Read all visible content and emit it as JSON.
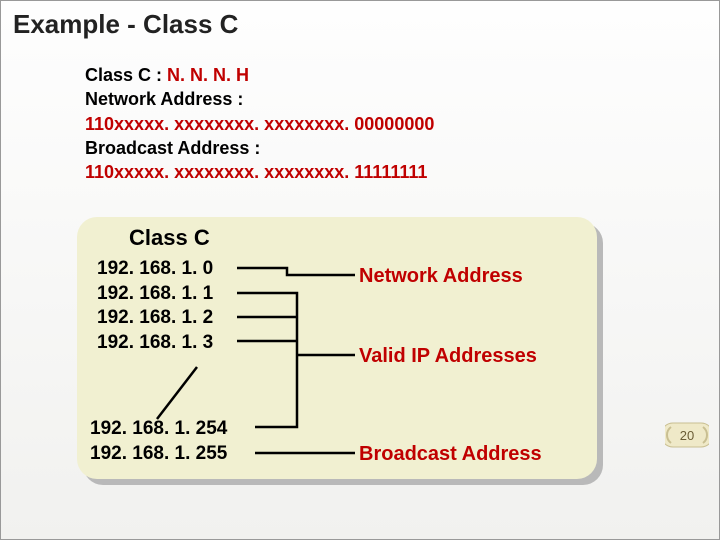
{
  "title": "Example - Class  C",
  "def": {
    "line1a": "Class C : ",
    "line1b": "N. N. N. H",
    "line2": "Network Address :",
    "line3": "110xxxxx. xxxxxxxx. xxxxxxxx. 00000000",
    "line4": "Broadcast Address :",
    "line5": "110xxxxx. xxxxxxxx. xxxxxxxx. 11111111"
  },
  "panel": {
    "heading": "Class C",
    "ips_top": [
      "192. 168. 1. 0",
      "192. 168. 1. 1",
      "192. 168. 1. 2",
      "192. 168. 1. 3"
    ],
    "ips_bottom": [
      "192. 168. 1. 254",
      "192. 168. 1. 255"
    ],
    "labels": {
      "network": "Network Address",
      "valid": "Valid IP Addresses",
      "broadcast": "Broadcast Address"
    }
  },
  "page_number": "20",
  "chart_data": {
    "type": "table",
    "title": "Class C address example (192.168.1.0/24)",
    "rows": [
      {
        "address": "192.168.1.0",
        "role": "Network Address"
      },
      {
        "address": "192.168.1.1",
        "role": "Valid IP Address"
      },
      {
        "address": "192.168.1.2",
        "role": "Valid IP Address"
      },
      {
        "address": "192.168.1.3",
        "role": "Valid IP Address"
      },
      {
        "address": "192.168.1.254",
        "role": "Valid IP Address"
      },
      {
        "address": "192.168.1.255",
        "role": "Broadcast Address"
      }
    ],
    "format": {
      "class": "C",
      "pattern": "N.N.N.H",
      "network_bits": "110xxxxx.xxxxxxxx.xxxxxxxx.00000000",
      "broadcast_bits": "110xxxxx.xxxxxxxx.xxxxxxxx.11111111"
    }
  }
}
